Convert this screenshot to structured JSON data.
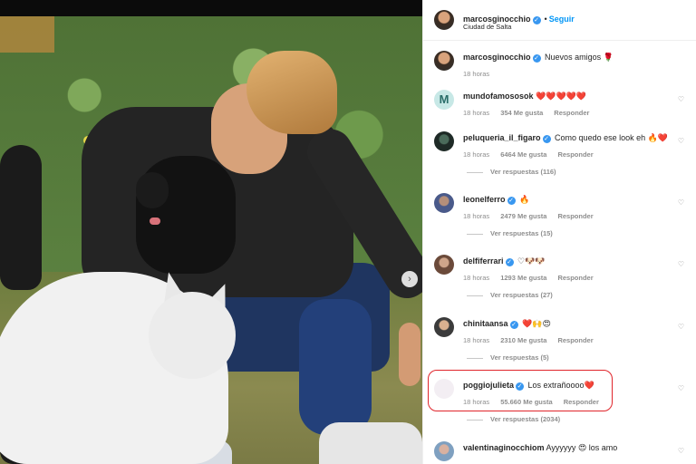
{
  "post": {
    "author": "marcosginocchio",
    "follow_label": "Seguir",
    "location": "Ciudad de Salta",
    "caption": "Nuevos amigos 🌹",
    "caption_time": "18 horas"
  },
  "comments": [
    {
      "user": "mundofamososok",
      "verified": false,
      "text": "❤️❤️❤️❤️❤️",
      "time": "18 horas",
      "likes": "354 Me gusta",
      "reply": "Responder",
      "replies": ""
    },
    {
      "user": "peluqueria_il_figaro",
      "verified": true,
      "text": "Como quedo ese look eh 🔥❤️",
      "time": "18 horas",
      "likes": "6464 Me gusta",
      "reply": "Responder",
      "replies": "Ver respuestas (116)"
    },
    {
      "user": "leonelferro",
      "verified": true,
      "text": "🔥",
      "time": "18 horas",
      "likes": "2479 Me gusta",
      "reply": "Responder",
      "replies": "Ver respuestas (15)"
    },
    {
      "user": "delfiferrari",
      "verified": true,
      "text": "♡🐶🐶",
      "time": "18 horas",
      "likes": "1293 Me gusta",
      "reply": "Responder",
      "replies": "Ver respuestas (27)"
    },
    {
      "user": "chinitaansa",
      "verified": true,
      "text": "❤️🙌😍",
      "time": "18 horas",
      "likes": "2310 Me gusta",
      "reply": "Responder",
      "replies": "Ver respuestas (5)"
    },
    {
      "user": "poggiojulieta",
      "verified": true,
      "text": "Los extrañoooo❤️",
      "time": "18 horas",
      "likes": "55.660 Me gusta",
      "reply": "Responder",
      "replies": "Ver respuestas (2034)"
    },
    {
      "user": "valentinaginocchiom",
      "verified": false,
      "text": "Ayyyyyy 😍 los amo",
      "time": "",
      "likes": "",
      "reply": "",
      "replies": ""
    }
  ],
  "icons": {
    "carousel_next": "chevron-right-icon",
    "verified": "verified-badge-icon",
    "like": "heart-outline-icon"
  },
  "colors": {
    "link_blue": "#0095f6",
    "verified_blue": "#3897f0",
    "highlight_red": "#e0252b"
  }
}
